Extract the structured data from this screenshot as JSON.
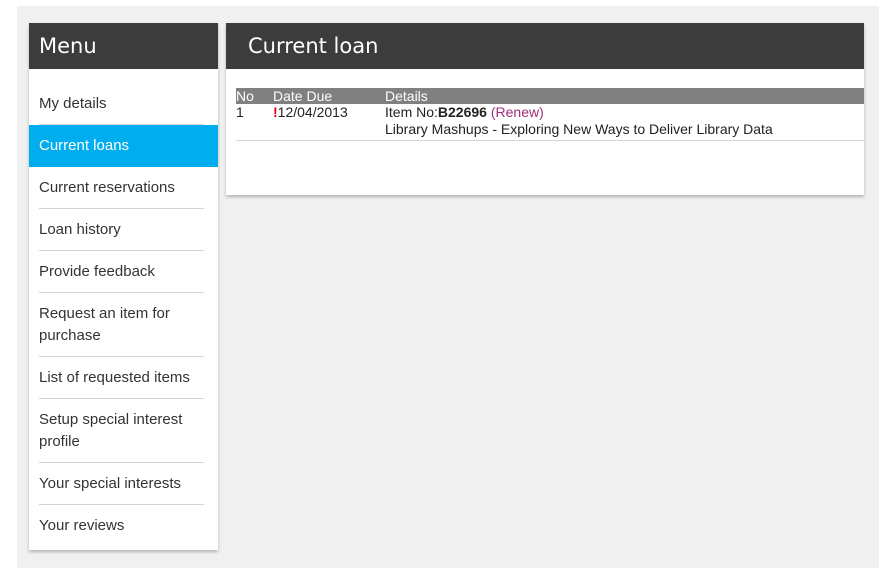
{
  "sidebar": {
    "title": "Menu",
    "items": [
      {
        "label": "My details",
        "active": false
      },
      {
        "label": "Current loans",
        "active": true
      },
      {
        "label": "Current reservations",
        "active": false
      },
      {
        "label": "Loan history",
        "active": false
      },
      {
        "label": "Provide feedback",
        "active": false
      },
      {
        "label": "Request an item for purchase",
        "active": false
      },
      {
        "label": "List of requested items",
        "active": false
      },
      {
        "label": "Setup special interest profile",
        "active": false
      },
      {
        "label": "Your special interests",
        "active": false
      },
      {
        "label": "Your reviews",
        "active": false
      }
    ]
  },
  "main": {
    "title": "Current loan",
    "table": {
      "headers": [
        "No",
        "Date Due",
        "Details"
      ],
      "rows": [
        {
          "no": "1",
          "overdue_marker": "!",
          "date_due": "12/04/2013",
          "item_prefix": "Item No:",
          "item_no": "B22696",
          "renew_open": "(",
          "renew_label": "Renew",
          "renew_close": ")",
          "title": "Library Mashups - Exploring New Ways to Deliver Library Data"
        }
      ]
    }
  },
  "colors": {
    "header_bg": "#3c3c3c",
    "active_item_bg": "#00aeef",
    "table_header_bg": "#808080",
    "overdue": "#e0001b",
    "link": "#a0307a",
    "page_bg": "#f0f0f0"
  }
}
